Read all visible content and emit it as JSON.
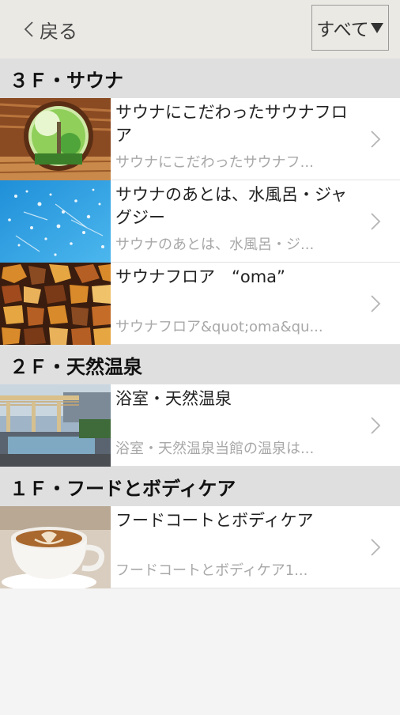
{
  "header": {
    "back_label": "戻る",
    "filter_label": "すべて"
  },
  "sections": [
    {
      "title": "３Ｆ・サウナ",
      "items": [
        {
          "title": "サウナにこだわったサウナフロア",
          "subtitle": "サウナにこだわったサウナフ..."
        },
        {
          "title": "サウナのあとは、水風呂・ジャグジー",
          "subtitle": "サウナのあとは、水風呂・ジ..."
        },
        {
          "title": "サウナフロア　“oma”",
          "subtitle": "サウナフロア&quot;oma&qu..."
        }
      ]
    },
    {
      "title": "２Ｆ・天然温泉",
      "items": [
        {
          "title": "浴室・天然温泉",
          "subtitle": "浴室・天然温泉当館の温泉は..."
        }
      ]
    },
    {
      "title": "１Ｆ・フードとボディケア",
      "items": [
        {
          "title": "フードコートとボディケア",
          "subtitle": "フードコートとボディケア1..."
        }
      ]
    }
  ],
  "icons": {
    "back": "chevron-left-icon",
    "filter": "triangle-down-icon",
    "row_arrow": "chevron-right-icon"
  },
  "colors": {
    "header_bg": "#ebe9e4",
    "section_bg": "#dfdfdf",
    "row_bg": "#ffffff",
    "subtitle": "#a8a8a8"
  }
}
